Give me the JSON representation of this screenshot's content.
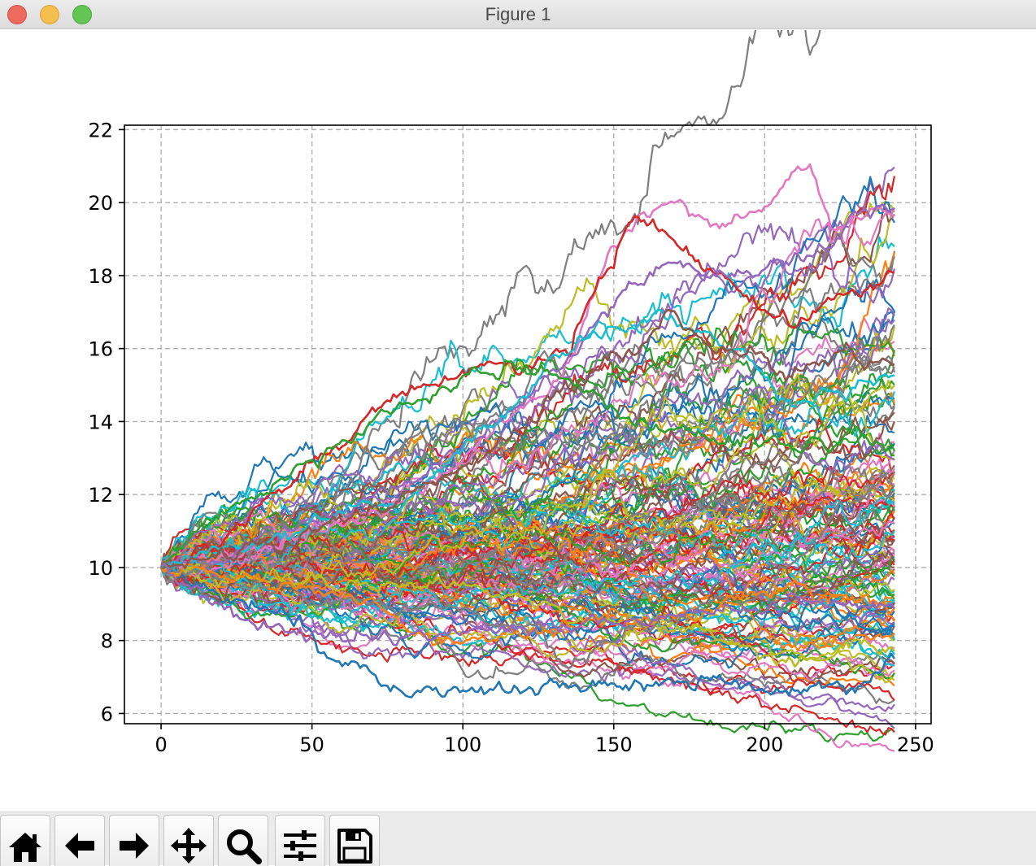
{
  "window": {
    "title": "Figure 1"
  },
  "toolbar": {
    "buttons": [
      {
        "name": "home-button",
        "icon": "home-icon"
      },
      {
        "name": "back-button",
        "icon": "arrow-left-icon"
      },
      {
        "name": "forward-button",
        "icon": "arrow-right-icon"
      },
      {
        "name": "pan-button",
        "icon": "move-icon"
      },
      {
        "name": "zoom-button",
        "icon": "magnifier-icon"
      },
      {
        "name": "configure-subplots-button",
        "icon": "sliders-icon"
      },
      {
        "name": "save-button",
        "icon": "floppy-disk-icon"
      }
    ]
  },
  "chart_data": {
    "type": "line",
    "title": "",
    "xlabel": "",
    "ylabel": "",
    "xlim": [
      -12.15,
      255.15
    ],
    "ylim": [
      5.72,
      22.12
    ],
    "xticks": [
      0,
      50,
      100,
      150,
      200,
      250
    ],
    "yticks": [
      6,
      8,
      10,
      12,
      14,
      16,
      18,
      20,
      22
    ],
    "grid": true,
    "grid_style": "dashed",
    "series_count": 150,
    "n_steps": 243,
    "start_value": 10,
    "colors": [
      "#1f77b4",
      "#ff7f0e",
      "#2ca02c",
      "#d62728",
      "#9467bd",
      "#8c564b",
      "#e377c2",
      "#7f7f7f",
      "#bcbd22",
      "#17becf"
    ],
    "highlighted_paths": [
      {
        "color": "#e377c2",
        "x": [
          0,
          40,
          80,
          100,
          120,
          135,
          150,
          160,
          172,
          185,
          200,
          215,
          222,
          235,
          243
        ],
        "y": [
          10,
          10.7,
          11.8,
          13.0,
          14.5,
          15.4,
          18.7,
          19.6,
          20.0,
          19.4,
          19.9,
          21.1,
          19.3,
          19.7,
          19.9
        ]
      },
      {
        "color": "#d62728",
        "x": [
          0,
          20,
          40,
          55,
          70,
          85,
          100,
          120,
          135,
          150,
          158,
          165,
          180,
          195,
          210,
          225,
          243
        ],
        "y": [
          10,
          10.9,
          12.0,
          13.0,
          14.2,
          14.9,
          15.4,
          15.5,
          16.1,
          18.6,
          19.6,
          19.2,
          18.2,
          17.1,
          16.6,
          17.5,
          17.8
        ]
      },
      {
        "color": "#9467bd",
        "x": [
          0,
          60,
          100,
          130,
          145,
          155,
          168,
          180,
          195,
          215,
          230,
          243
        ],
        "y": [
          10,
          11.5,
          13.2,
          15.3,
          16.7,
          17.6,
          18.5,
          17.9,
          18.1,
          18.4,
          19.6,
          19.8
        ]
      },
      {
        "color": "#17becf",
        "x": [
          0,
          50,
          80,
          110,
          130,
          150,
          165,
          175,
          190,
          210,
          230,
          243
        ],
        "y": [
          10,
          11.2,
          11.8,
          13.8,
          15.8,
          16.3,
          16.8,
          16.5,
          15.9,
          14.6,
          15.0,
          15.3
        ]
      },
      {
        "color": "#1f77b4",
        "x": [
          0,
          20,
          45,
          55,
          60,
          70,
          80,
          100,
          120,
          150,
          170,
          190,
          200,
          215,
          230,
          243
        ],
        "y": [
          10,
          9.2,
          8.7,
          7.6,
          7.4,
          7.2,
          6.6,
          6.8,
          6.6,
          6.9,
          6.8,
          7.0,
          6.8,
          6.8,
          6.7,
          7.4
        ]
      },
      {
        "color": "#bcbd22",
        "x": [
          0,
          60,
          100,
          140,
          160,
          180,
          200,
          215,
          230,
          243
        ],
        "y": [
          10,
          9.6,
          9.5,
          8.6,
          8.4,
          8.2,
          7.5,
          7.5,
          7.9,
          7.6
        ]
      },
      {
        "color": "#7f7f7f",
        "x": [
          0,
          60,
          100,
          125,
          135,
          145,
          160,
          180,
          200,
          225,
          243
        ],
        "y": [
          10,
          9.1,
          8.8,
          8.3,
          7.3,
          7.9,
          8.4,
          8.9,
          9.4,
          11.6,
          12.2
        ]
      },
      {
        "color": "#ff7f0e",
        "x": [
          0,
          40,
          70,
          90,
          110,
          130,
          150,
          170,
          190,
          210,
          225,
          243
        ],
        "y": [
          10,
          9.6,
          9.0,
          8.0,
          8.0,
          8.3,
          8.6,
          8.6,
          8.9,
          9.6,
          9.2,
          9.0
        ]
      },
      {
        "color": "#8c564b",
        "x": [
          0,
          60,
          100,
          130,
          145,
          160,
          168,
          180,
          195,
          205,
          225,
          243
        ],
        "y": [
          10,
          11.2,
          12.7,
          14.6,
          15.5,
          16.3,
          16.9,
          16.1,
          15.7,
          15.2,
          15.8,
          15.4
        ]
      },
      {
        "color": "#2ca02c",
        "x": [
          0,
          20,
          40,
          60,
          80,
          95,
          110,
          125,
          140,
          150,
          170,
          190,
          210,
          230,
          243
        ],
        "y": [
          10,
          11.5,
          12.4,
          13.3,
          14.4,
          15.0,
          15.3,
          15.4,
          15.0,
          14.3,
          13.8,
          13.6,
          13.4,
          13.6,
          13.2
        ]
      },
      {
        "color": "#9467bd",
        "x": [
          0,
          15,
          30,
          45,
          60,
          75,
          90,
          105,
          120,
          150,
          180,
          210,
          243
        ],
        "y": [
          10,
          9.2,
          8.4,
          8.3,
          8.3,
          8.1,
          8.1,
          8.3,
          8.4,
          8.5,
          8.7,
          9.0,
          9.0
        ]
      }
    ]
  }
}
